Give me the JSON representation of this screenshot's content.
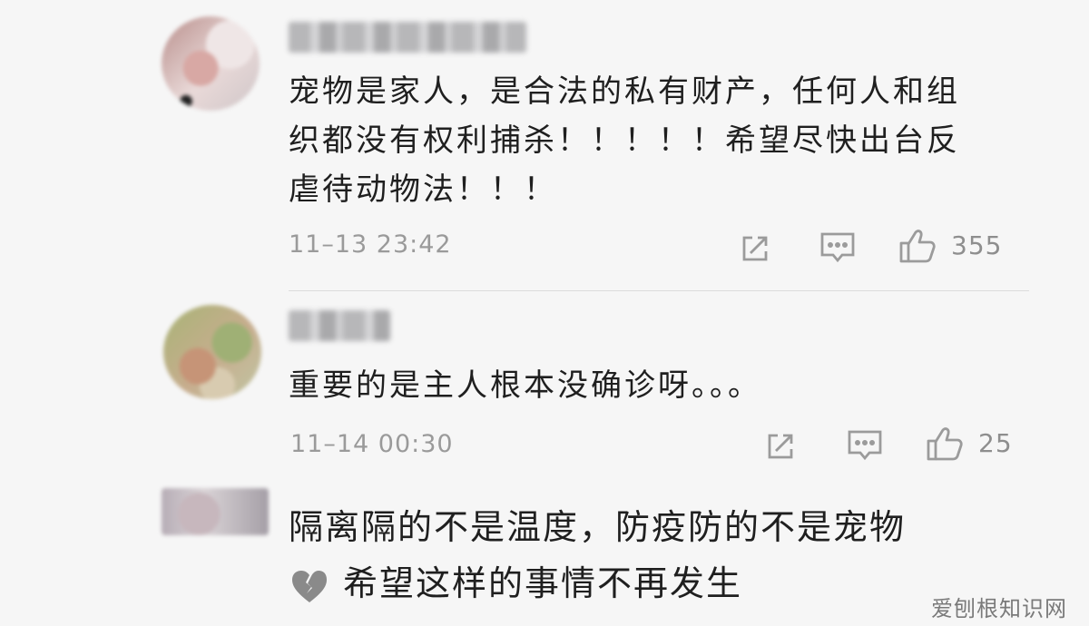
{
  "comments": [
    {
      "text_lines": [
        "宠物是家人，是合法的私有财产，任何人和组",
        "织都没有权利捕杀！！！！！希望尽快出台反",
        "虐待动物法！！！"
      ],
      "timestamp": "11–13 23:42",
      "likes": "355",
      "icons": {
        "share": "share-icon",
        "reply": "reply-icon",
        "like": "thumbs-up-icon"
      }
    },
    {
      "text_lines": [
        "重要的是主人根本没确诊呀。。。"
      ],
      "timestamp": "11–14 00:30",
      "likes": "25",
      "icons": {
        "share": "share-icon",
        "reply": "reply-icon",
        "like": "thumbs-up-icon"
      }
    },
    {
      "text_lines": [
        "隔离隔的不是温度，防疫防的不是宠物",
        "希望这样的事情不再发生"
      ],
      "leading_emoji": "broken-heart-icon"
    }
  ],
  "watermark": "爱刨根知识网",
  "colors": {
    "background": "#f6f6f6",
    "text": "#1f1f1f",
    "muted": "#9a9a9a",
    "divider": "#dcdcdc"
  }
}
